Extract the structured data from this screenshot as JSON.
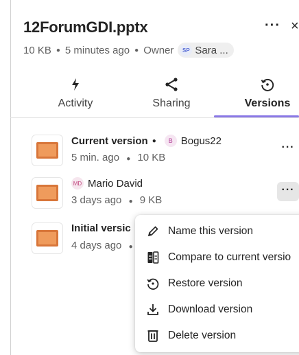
{
  "file": {
    "title": "12ForumGDI.pptx",
    "size": "10 KB",
    "modified": "5 minutes ago",
    "owner_label": "Owner",
    "owner_initials": "SP",
    "owner_name": "Sara ...",
    "more_label": "···",
    "close_label": "×"
  },
  "tabs": [
    {
      "label": "Activity",
      "icon": "lightning-icon",
      "active": false
    },
    {
      "label": "Sharing",
      "icon": "share-icon",
      "active": false
    },
    {
      "label": "Versions",
      "icon": "history-icon",
      "active": true
    }
  ],
  "versions": [
    {
      "title": "Current version",
      "author_initials": "B",
      "author": "Bogus22",
      "time": "5 min. ago",
      "size": "10 KB",
      "more": "···"
    },
    {
      "title": "",
      "author_initials": "MD",
      "author": "Mario David",
      "time": "3 days ago",
      "size": "9 KB",
      "more": "···"
    },
    {
      "title": "Initial versic",
      "author_initials": "",
      "author": "",
      "time": "4 days ago",
      "size": "",
      "more": ""
    }
  ],
  "context_menu": {
    "items": [
      {
        "label": "Name this version",
        "icon": "pencil-icon"
      },
      {
        "label": "Compare to current versio",
        "icon": "compare-icon"
      },
      {
        "label": "Restore version",
        "icon": "restore-icon"
      },
      {
        "label": "Download version",
        "icon": "download-icon"
      },
      {
        "label": "Delete version",
        "icon": "trash-icon"
      }
    ]
  },
  "colors": {
    "accent_underline": "#8a78e6",
    "pptx_orange": "#ef9b5c",
    "pptx_border": "#d8763a"
  }
}
